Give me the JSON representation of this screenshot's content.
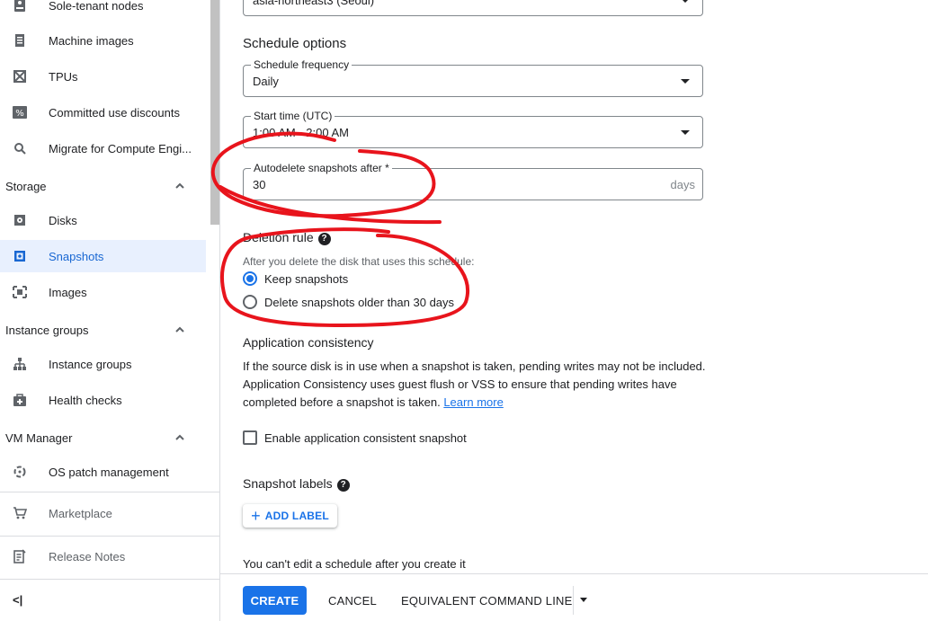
{
  "sidebar": {
    "items_top": [
      {
        "label": "Sole-tenant nodes",
        "icon": "server-icon"
      },
      {
        "label": "Machine images",
        "icon": "machine-image-icon"
      },
      {
        "label": "TPUs",
        "icon": "tpu-icon"
      },
      {
        "label": "Committed use discounts",
        "icon": "percent-icon"
      },
      {
        "label": "Migrate for Compute Engi...",
        "icon": "search-icon"
      }
    ],
    "storage": {
      "title": "Storage",
      "items": [
        {
          "label": "Disks",
          "icon": "disk-icon"
        },
        {
          "label": "Snapshots",
          "icon": "snapshot-icon",
          "active": true
        },
        {
          "label": "Images",
          "icon": "image-icon"
        }
      ]
    },
    "instance_groups": {
      "title": "Instance groups",
      "items": [
        {
          "label": "Instance groups",
          "icon": "instance-groups-icon"
        },
        {
          "label": "Health checks",
          "icon": "health-check-icon"
        }
      ]
    },
    "vm_manager": {
      "title": "VM Manager",
      "items": [
        {
          "label": "OS patch management",
          "icon": "patch-icon"
        }
      ]
    },
    "marketplace": "Marketplace",
    "release_notes": "Release Notes",
    "collapse_glyph": "<|"
  },
  "main": {
    "region_value": "asia-northeast3 (Seoul)",
    "schedule_options_title": "Schedule options",
    "schedule_frequency": {
      "label": "Schedule frequency",
      "value": "Daily"
    },
    "start_time": {
      "label": "Start time (UTC)",
      "value": "1:00 AM - 2:00 AM"
    },
    "autodelete": {
      "label": "Autodelete snapshots after *",
      "value": "30",
      "suffix": "days"
    },
    "deletion_rule": {
      "title": "Deletion rule",
      "help": "?",
      "hint": "After you delete the disk that uses this schedule:",
      "options": [
        {
          "label": "Keep snapshots",
          "checked": true
        },
        {
          "label": "Delete snapshots older than 30 days",
          "checked": false
        }
      ]
    },
    "app_consistency": {
      "title": "Application consistency",
      "text": "If the source disk is in use when a snapshot is taken, pending writes may not be included. Application Consistency uses guest flush or VSS to ensure that pending writes have completed before a snapshot is taken.",
      "link": "Learn more",
      "checkbox_label": "Enable application consistent snapshot",
      "checkbox_checked": false
    },
    "snapshot_labels": {
      "title": "Snapshot labels",
      "help": "?",
      "add_label_button": "ADD LABEL"
    },
    "edit_note": "You can't edit a schedule after you create it"
  },
  "footer": {
    "create": "CREATE",
    "cancel": "CANCEL",
    "equivalent": "EQUIVALENT COMMAND LINE"
  },
  "colors": {
    "accent": "#1a73e8",
    "annotation": "#e8141c",
    "active_bg": "#e8f0fe"
  }
}
